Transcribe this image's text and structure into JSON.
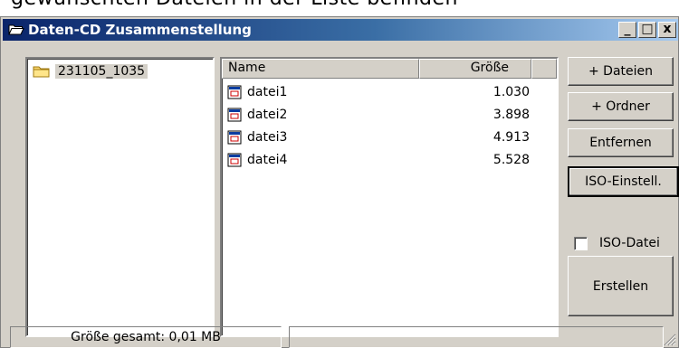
{
  "background_text": "gewünschten Dateien in der Liste befinden",
  "window": {
    "title": "Daten-CD Zusammenstellung",
    "controls": {
      "minimize": "_",
      "maximize": "□",
      "close": "x"
    }
  },
  "folder_tree": {
    "items": [
      {
        "label": "231105_1035",
        "icon": "folder-icon"
      }
    ]
  },
  "file_list": {
    "columns": {
      "name": "Name",
      "size": "Größe"
    },
    "rows": [
      {
        "name": "datei1",
        "size": "1.030"
      },
      {
        "name": "datei2",
        "size": "3.898"
      },
      {
        "name": "datei3",
        "size": "4.913"
      },
      {
        "name": "datei4",
        "size": "5.528"
      }
    ]
  },
  "buttons": {
    "add_files": "+ Dateien",
    "add_folder": "+ Ordner",
    "remove": "Entfernen",
    "iso_settings": "ISO-Einstell.",
    "create": "Erstellen"
  },
  "iso_checkbox": {
    "label": "ISO-Datei",
    "checked": false
  },
  "status": {
    "total_size": "Größe gesamt: 0,01 MB",
    "secondary": ""
  },
  "colors": {
    "titlebar_start": "#0a246a",
    "titlebar_end": "#a6caf0",
    "face": "#d4d0c8"
  }
}
